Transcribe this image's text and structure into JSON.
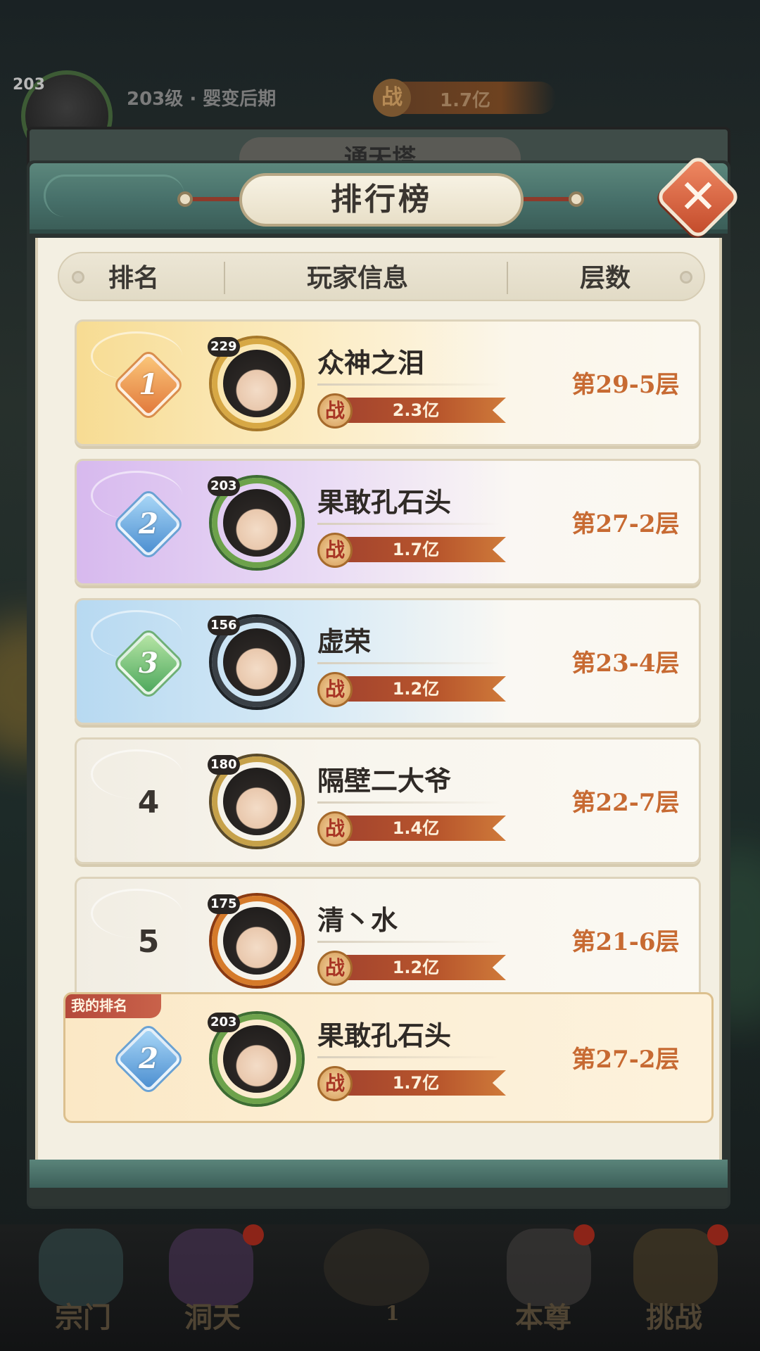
{
  "hud": {
    "level_badge": "203",
    "level_title": "203级 · 婴变后期",
    "power_icon": "战",
    "power_value": "1.7亿"
  },
  "back_panel": {
    "title": "通天塔"
  },
  "modal": {
    "title": "排行榜",
    "close_label": "✕",
    "columns": {
      "rank": "排名",
      "player": "玩家信息",
      "floors": "层数"
    }
  },
  "power_icon_text": "战",
  "rows": [
    {
      "rank": "1",
      "rank_style": "gold",
      "level": "229",
      "name": "众神之泪",
      "power": "2.3亿",
      "floor": "第29-5层",
      "frame": "gold"
    },
    {
      "rank": "2",
      "rank_style": "blue",
      "level": "203",
      "name": "果敢孔石头",
      "power": "1.7亿",
      "floor": "第27-2层",
      "frame": "green"
    },
    {
      "rank": "3",
      "rank_style": "green",
      "level": "156",
      "name": "虚荣",
      "power": "1.2亿",
      "floor": "第23-4层",
      "frame": "dark"
    },
    {
      "rank": "4",
      "rank_style": "plain",
      "level": "180",
      "name": "隔壁二大爷",
      "power": "1.4亿",
      "floor": "第22-7层",
      "frame": "golddark"
    },
    {
      "rank": "5",
      "rank_style": "plain",
      "level": "175",
      "name": "清丶水",
      "power": "1.2亿",
      "floor": "第21-6层",
      "frame": "fire"
    }
  ],
  "my_rank": {
    "tag": "我的排名",
    "rank": "2",
    "rank_style": "blue",
    "level": "203",
    "name": "果敢孔石头",
    "power": "1.7亿",
    "floor": "第27-2层"
  },
  "bottom_nav": [
    {
      "label": "宗门",
      "icon": "sect-icon"
    },
    {
      "label": "洞天",
      "icon": "cave-icon"
    },
    {
      "label": "1",
      "icon": "center-compass-icon"
    },
    {
      "label": "本尊",
      "icon": "character-icon"
    },
    {
      "label": "挑战",
      "icon": "challenge-icon"
    }
  ],
  "colors": {
    "accent_floor": "#c76a32",
    "header_teal": "#47706a",
    "close_orange": "#e0643c"
  }
}
